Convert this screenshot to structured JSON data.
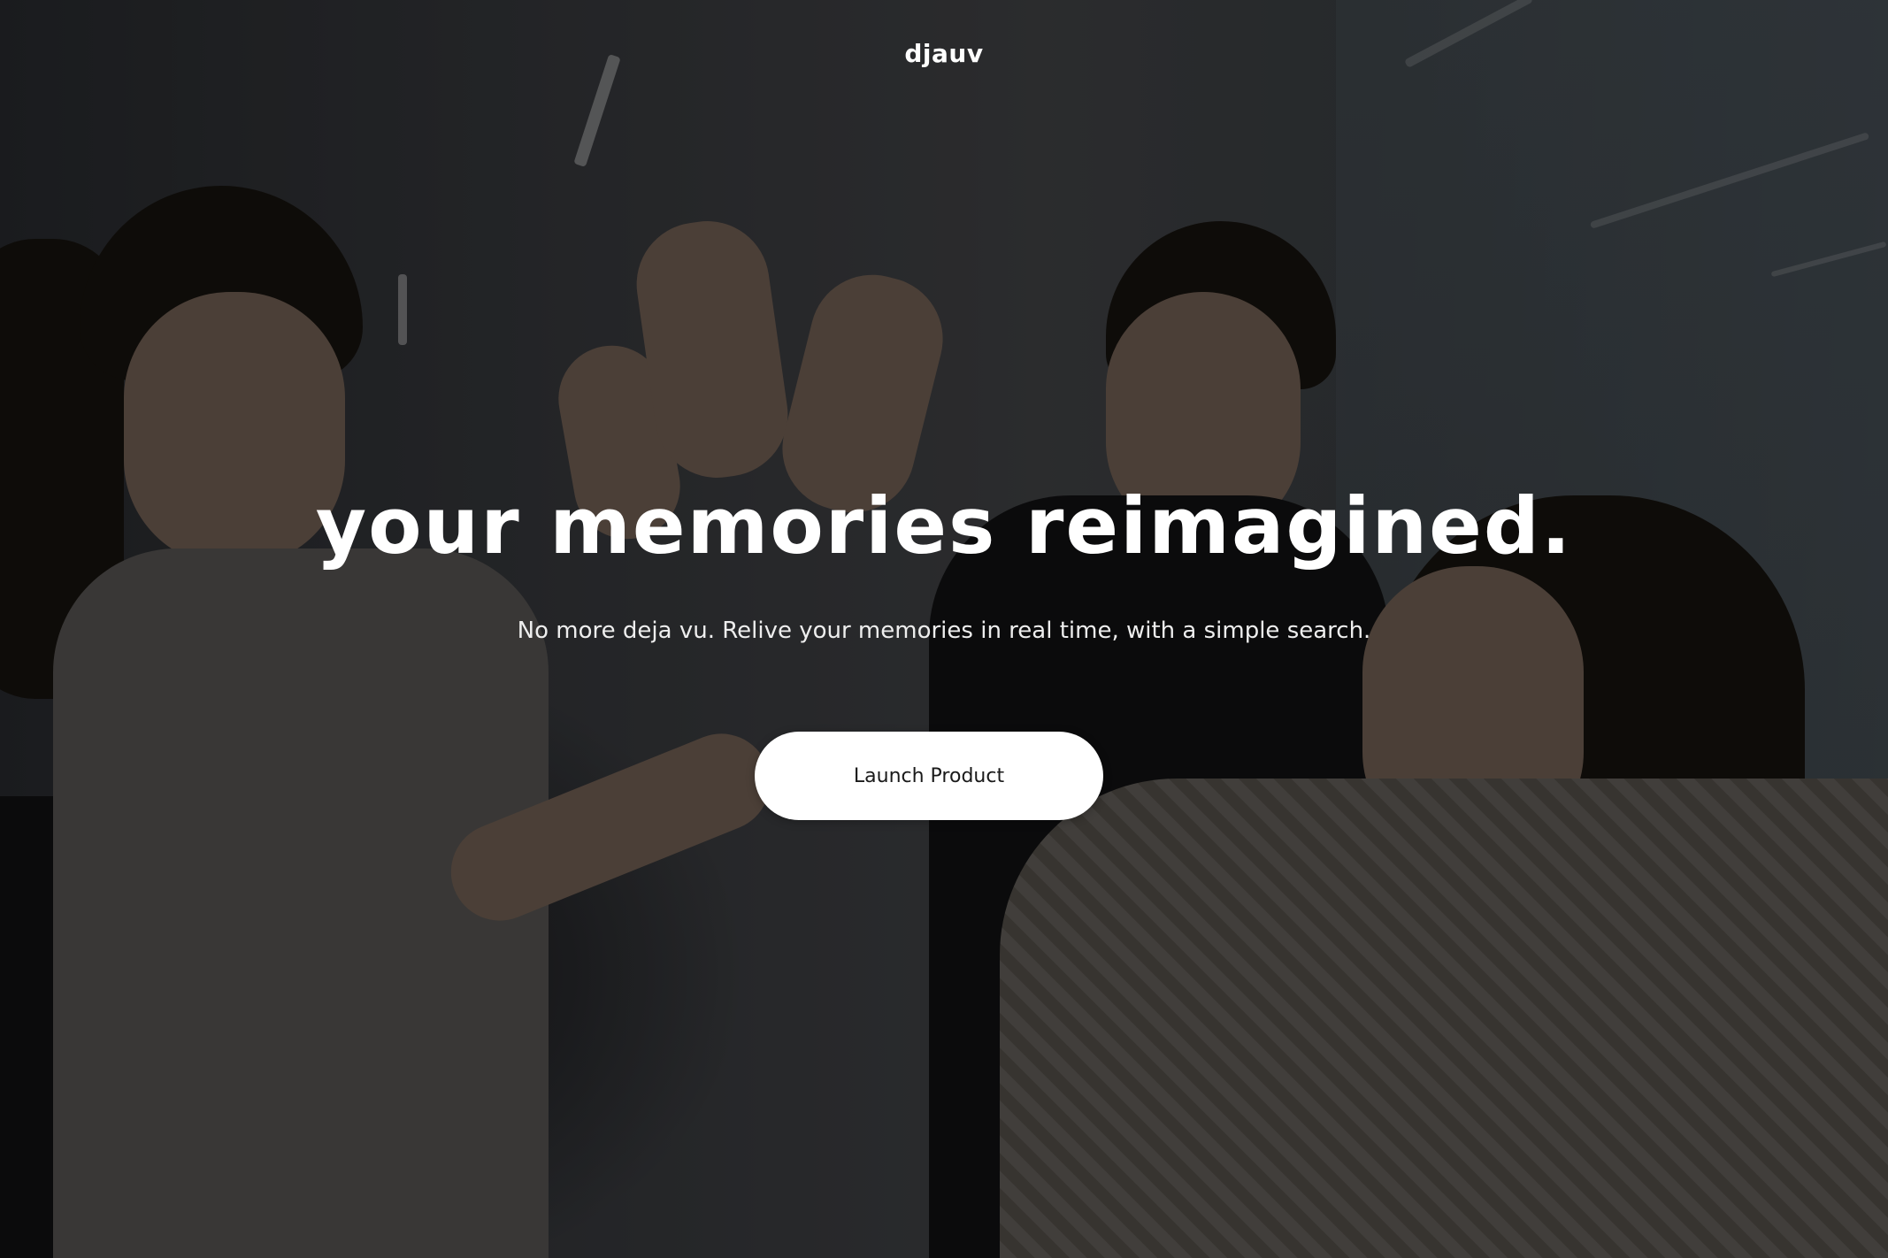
{
  "brand": {
    "name": "djauv"
  },
  "hero": {
    "headline": "your memories reimagined.",
    "subheadline": "No more deja vu. Relive your memories in real time, with a simple search.",
    "background_image": "photo of people giving high-fives in a hallway"
  },
  "cta": {
    "label": "Launch Product"
  },
  "colors": {
    "text": "#ffffff",
    "button_bg": "#ffffff",
    "button_text": "#1a1a1a"
  }
}
